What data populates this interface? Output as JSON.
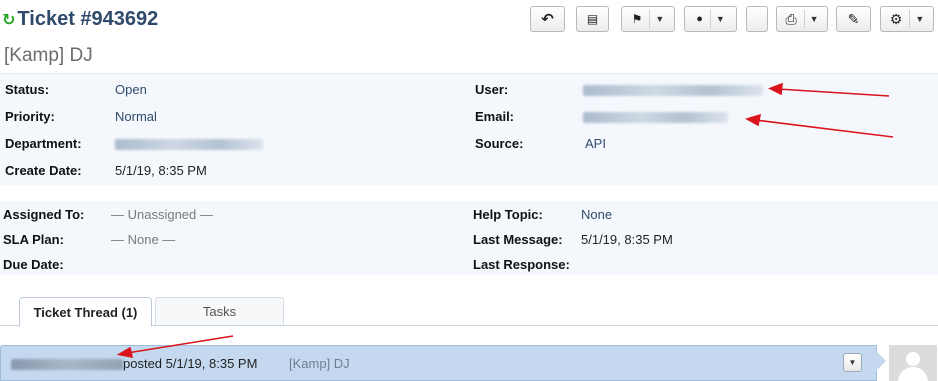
{
  "header": {
    "refresh_icon": "↻",
    "title": "Ticket #943692",
    "subject": "[Kamp] DJ"
  },
  "toolbar": {
    "buttons": [
      {
        "name": "reply-icon",
        "glyph": "↶",
        "has_caret": false
      },
      {
        "name": "document-icon",
        "glyph": "▤",
        "has_caret": false
      },
      {
        "name": "flag-icon",
        "glyph": "⚑",
        "has_caret": true
      },
      {
        "name": "user-icon",
        "glyph": "👤",
        "has_caret": true
      },
      {
        "name": "blank",
        "glyph": "",
        "has_caret": false
      },
      {
        "name": "print-icon",
        "glyph": "⎙",
        "has_caret": true
      },
      {
        "name": "edit-icon",
        "glyph": "✎",
        "has_caret": false
      },
      {
        "name": "gear-icon",
        "glyph": "⚙",
        "has_caret": true
      }
    ],
    "caret": "▼"
  },
  "info_top": {
    "status_label": "Status:",
    "status_value": "Open",
    "priority_label": "Priority:",
    "priority_value": "Normal",
    "department_label": "Department:",
    "create_date_label": "Create Date:",
    "create_date_value": "5/1/19, 8:35 PM",
    "user_label": "User:",
    "email_label": "Email:",
    "source_label": "Source:",
    "source_value": "API"
  },
  "info_bottom": {
    "assigned_label": "Assigned To:",
    "assigned_value": "— Unassigned —",
    "sla_label": "SLA Plan:",
    "sla_value": "— None —",
    "due_label": "Due Date:",
    "help_topic_label": "Help Topic:",
    "help_topic_value": "None",
    "last_message_label": "Last Message:",
    "last_message_value": "5/1/19, 8:35 PM",
    "last_response_label": "Last Response:"
  },
  "tabs": [
    {
      "label": "Ticket Thread (1)",
      "active": true
    },
    {
      "label": "Tasks",
      "active": false
    }
  ],
  "thread": {
    "posted_text": "posted 5/1/19, 8:35 PM",
    "subject": "[Kamp] DJ",
    "dropdown_caret": "▼"
  },
  "colors": {
    "accent_title": "#2f4a6b",
    "refresh": "#1ea91e",
    "annotation_arrow": "#d9141b",
    "thread_bg": "#c4d8ef"
  }
}
